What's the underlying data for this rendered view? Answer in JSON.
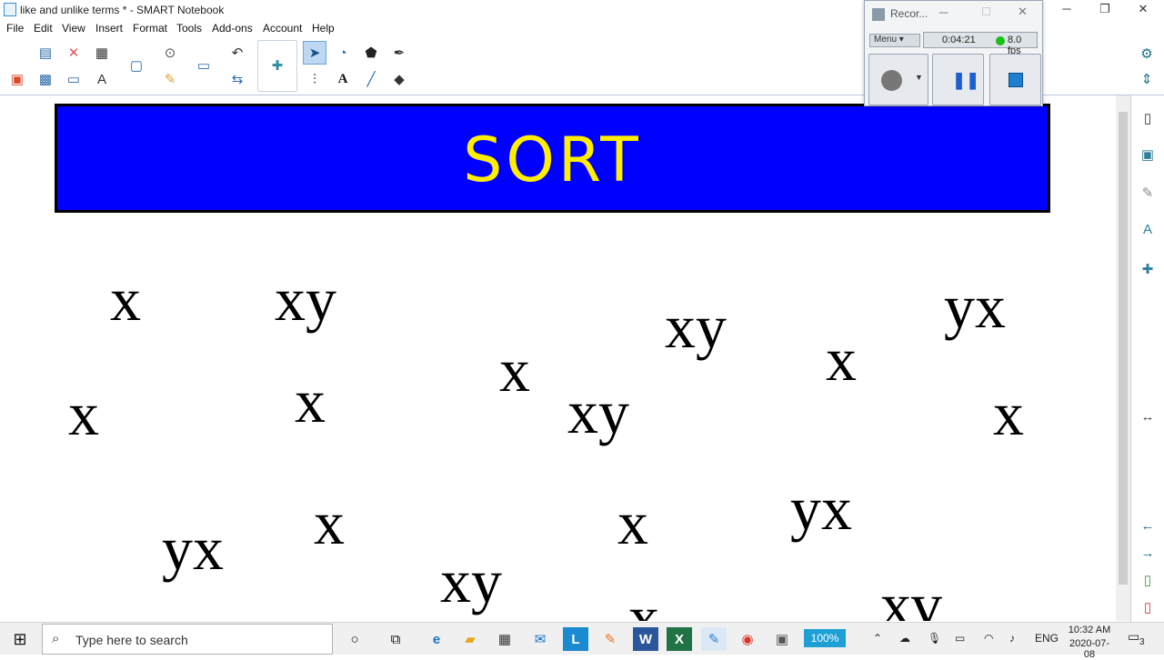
{
  "window": {
    "title": "like and unlike terms * - SMART Notebook",
    "minimize": "─",
    "restore": "❐",
    "close": "✕"
  },
  "menu": [
    "File",
    "Edit",
    "View",
    "Insert",
    "Format",
    "Tools",
    "Add-ons",
    "Account",
    "Help"
  ],
  "toolbar": {
    "icons": [
      "new-page-icon",
      "delete-icon",
      "table-icon",
      "capture-icon",
      "undo-icon",
      "save-icon",
      "screen-shade-icon",
      "spell-icon",
      "document-camera-icon",
      "response-icon",
      "redo-icon",
      "full-screen-icon",
      "add-ons-icon",
      "select-icon",
      "shapes-icon",
      "fill-icon",
      "pen-icon",
      "creative-pen-icon",
      "text-icon",
      "line-icon",
      "eraser-icon"
    ]
  },
  "canvas": {
    "banner_text": "SORT",
    "banner_color": "#0000ff",
    "banner_text_color": "#ffee00",
    "terms": [
      "x",
      "xy",
      "xy",
      "yx",
      "x",
      "x",
      "x",
      "xy",
      "x",
      "x",
      "x",
      "yx",
      "x",
      "yx",
      "xy",
      "x",
      "xv"
    ]
  },
  "recorder": {
    "title": "Recor...",
    "menu_label": "Menu",
    "time": "0:04:21",
    "fps": "8.0 fps"
  },
  "taskbar": {
    "search_placeholder": "Type here to search",
    "zoom": "100%",
    "language": "ENG",
    "time": "10:32 AM",
    "date": "2020-07-08",
    "notifications": "3"
  }
}
